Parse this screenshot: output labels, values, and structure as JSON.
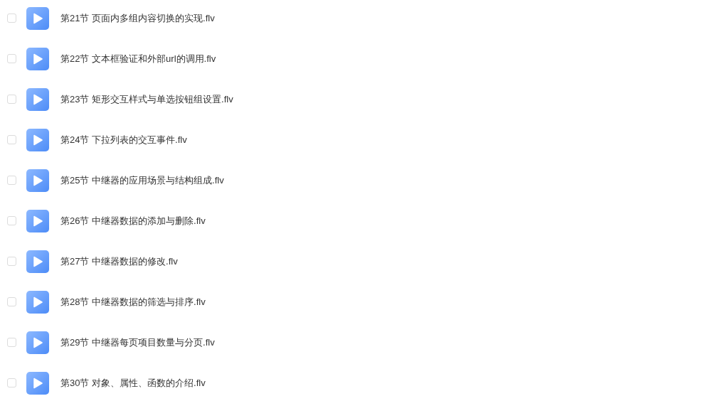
{
  "files": [
    {
      "name": "第21节 页面内多组内容切换的实现.flv",
      "checked": false
    },
    {
      "name": "第22节 文本框验证和外部url的调用.flv",
      "checked": false
    },
    {
      "name": "第23节 矩形交互样式与单选按钮组设置.flv",
      "checked": false
    },
    {
      "name": "第24节 下拉列表的交互事件.flv",
      "checked": false
    },
    {
      "name": "第25节 中继器的应用场景与结构组成.flv",
      "checked": false
    },
    {
      "name": "第26节 中继器数据的添加与删除.flv",
      "checked": false
    },
    {
      "name": "第27节 中继器数据的修改.flv",
      "checked": false
    },
    {
      "name": "第28节 中继器数据的筛选与排序.flv",
      "checked": false
    },
    {
      "name": "第29节 中继器每页项目数量与分页.flv",
      "checked": false
    },
    {
      "name": "第30节 对象、属性、函数的介绍.flv",
      "checked": false
    }
  ]
}
